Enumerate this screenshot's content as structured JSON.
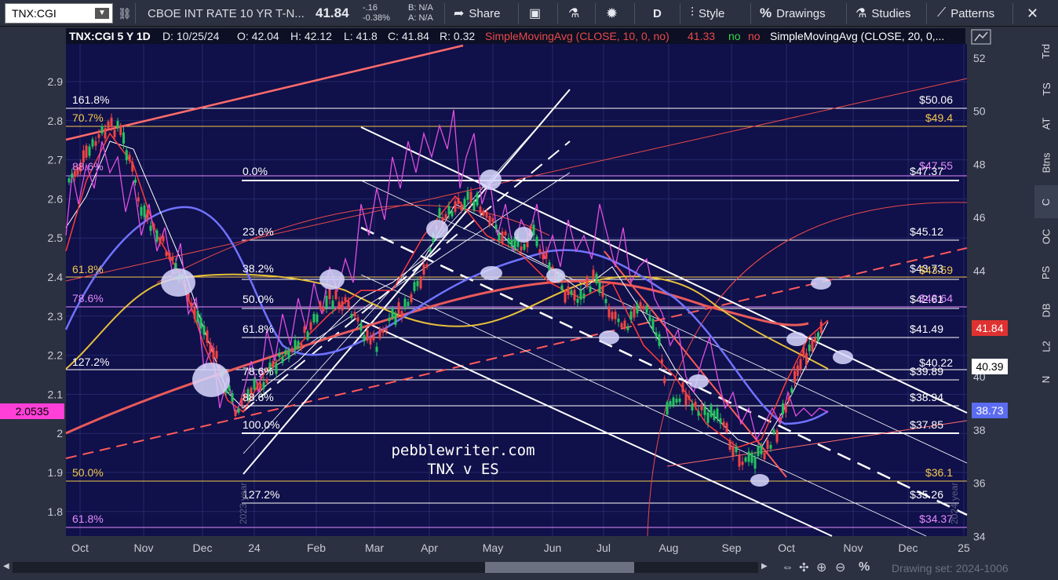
{
  "toolbar": {
    "symbol": "TNX:CGI",
    "description": "CBOE INT RATE 10 YR T-N...",
    "last_price": "41.84",
    "change": "-.16",
    "change_pct": "-0.38%",
    "bid": "B: N/A",
    "ask": "A: N/A",
    "share_label": "Share",
    "period_label": "D",
    "style_label": "Style",
    "drawings_label": "Drawings",
    "studies_label": "Studies",
    "patterns_label": "Patterns"
  },
  "legend": {
    "symbol_period": "TNX:CGI 5 Y 1D",
    "date": "D: 10/25/24",
    "open": "O: 42.04",
    "high": "H: 42.12",
    "low": "L: 41.8",
    "close": "C: 41.84",
    "range": "R: 0.32",
    "sma10_label": "SimpleMovingAvg (CLOSE, 10, 0, no)",
    "sma10_value": "41.33",
    "flag_no1": "no",
    "flag_no2": "no",
    "sma20_label": "SimpleMovingAvg (CLOSE, 20, 0,..."
  },
  "right_axis": {
    "ticks": [
      "52",
      "50",
      "48",
      "46",
      "44",
      "42",
      "40",
      "38",
      "36",
      "34"
    ],
    "price_tag": "41.84",
    "price_tag_color": "#e03131",
    "tag_white": "40.39",
    "tag_blue": "38.73",
    "tag_blue_color": "#5b6cf0"
  },
  "left_axis": {
    "ticks": [
      "2.9",
      "2.8",
      "2.7",
      "2.6",
      "2.5",
      "2.4",
      "2.3",
      "2.2",
      "2.1",
      "2",
      "1.9",
      "1.8"
    ],
    "es_tag": "2.0535",
    "es_tag_color": "#ff3fd8"
  },
  "x_axis": {
    "labels": [
      "Oct",
      "Nov",
      "Dec",
      "24",
      "Feb",
      "Mar",
      "Apr",
      "May",
      "Jun",
      "Jul",
      "Aug",
      "Sep",
      "Oct",
      "Nov",
      "Dec",
      "25"
    ],
    "watermark_2023": "2023 year",
    "watermark_2024": "2024 year"
  },
  "fib_levels": {
    "upper_left": [
      {
        "label": "161.8%",
        "color": "#ffffff"
      },
      {
        "label": "70.7%",
        "color": "#f2c94c"
      },
      {
        "label": "88.6%",
        "color": "#e58bff"
      },
      {
        "label": "61.8%",
        "color": "#f2c94c"
      },
      {
        "label": "78.6%",
        "color": "#e58bff"
      },
      {
        "label": "127.2%",
        "color": "#ffffff"
      },
      {
        "label": "50.0%",
        "color": "#f2c94c"
      },
      {
        "label": "61.8%",
        "color": "#e58bff"
      }
    ],
    "middle": [
      {
        "label": "0.0%"
      },
      {
        "label": "23.6%"
      },
      {
        "label": "38.2%"
      },
      {
        "label": "50.0%"
      },
      {
        "label": "61.8%"
      },
      {
        "label": "78.6%"
      },
      {
        "label": "88.6%"
      },
      {
        "label": "100.0%"
      },
      {
        "label": "127.2%"
      }
    ],
    "right_values": [
      {
        "label": "$50.06",
        "color": "#ffffff"
      },
      {
        "label": "$49.4",
        "color": "#f2c94c"
      },
      {
        "label": "$47.55",
        "color": "#e58bff"
      },
      {
        "label": "$47.37",
        "color": "#ffffff"
      },
      {
        "label": "$45.12",
        "color": "#ffffff"
      },
      {
        "label": "$43.73",
        "color": "#ffffff"
      },
      {
        "label": "$43.59",
        "color": "#f2c94c"
      },
      {
        "label": "$42.61",
        "color": "#ffffff"
      },
      {
        "label": "$42.64",
        "color": "#e58bff"
      },
      {
        "label": "$41.49",
        "color": "#ffffff"
      },
      {
        "label": "$40.22",
        "color": "#ffffff"
      },
      {
        "label": "$39.89",
        "color": "#ffffff"
      },
      {
        "label": "$38.94",
        "color": "#ffffff"
      },
      {
        "label": "$37.85",
        "color": "#ffffff"
      },
      {
        "label": "$36.1",
        "color": "#f2c94c"
      },
      {
        "label": "$35.26",
        "color": "#ffffff"
      },
      {
        "label": "$34.37",
        "color": "#e58bff"
      }
    ]
  },
  "overlay_text": {
    "line1": "pebblewriter.com",
    "line2": "TNX v ES"
  },
  "side_tabs": [
    "Trd",
    "TS",
    "AT",
    "Btns",
    "C",
    "OC",
    "PS",
    "DB",
    "L2",
    "N"
  ],
  "footer": {
    "drawing_set": "Drawing set: 2024-1006"
  }
}
